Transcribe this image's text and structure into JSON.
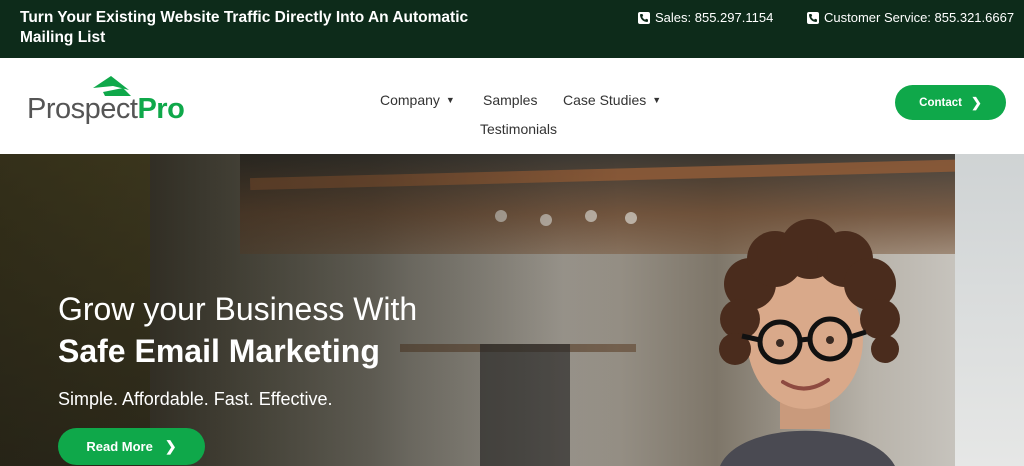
{
  "topbar": {
    "tagline": "Turn Your Existing Website Traffic Directly Into An Automatic Mailing List",
    "sales": "Sales: 855.297.1154",
    "customer_service": "Customer Service: 855.321.6667",
    "icons": [
      "phone-icon",
      "phone-icon"
    ]
  },
  "logo": {
    "part1": "Prospect",
    "part2": "Pro"
  },
  "nav": {
    "company": "Company",
    "samples": "Samples",
    "case_studies": "Case Studies",
    "testimonials": "Testimonials"
  },
  "header": {
    "contact_label": "Contact"
  },
  "hero": {
    "line1": "Grow your Business With",
    "line2": "Safe Email Marketing",
    "subtitle": "Simple. Affordable. Fast. Effective.",
    "read_more_label": "Read More"
  },
  "colors": {
    "topbar_bg": "#0d2b1a",
    "brand_green": "#0fa84a",
    "nav_text": "#333333"
  }
}
